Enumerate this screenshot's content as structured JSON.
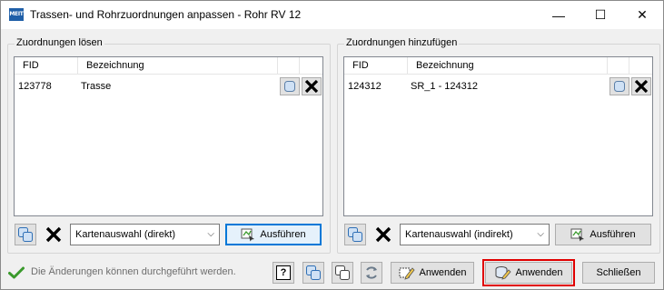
{
  "window": {
    "icon_text": "MEIT",
    "title": "Trassen- und Rohrzuordnungen anpassen - Rohr RV 12",
    "controls": {
      "minimize": "—",
      "maximize": "☐",
      "close": "✕"
    }
  },
  "left_group": {
    "label": "Zuordnungen lösen",
    "columns": [
      "FID",
      "Bezeichnung"
    ],
    "rows": [
      {
        "fid": "123778",
        "bezeichnung": "Trasse"
      }
    ],
    "dropdown_value": "Kartenauswahl (direkt)",
    "run_label": "Ausführen"
  },
  "right_group": {
    "label": "Zuordnungen hinzufügen",
    "columns": [
      "FID",
      "Bezeichnung"
    ],
    "rows": [
      {
        "fid": "124312",
        "bezeichnung": "SR_1 - 124312"
      }
    ],
    "dropdown_value": "Kartenauswahl (indirekt)",
    "run_label": "Ausführen"
  },
  "footer": {
    "status_text": "Die Änderungen können durchgeführt werden.",
    "help_label": "?",
    "apply_label_1": "Anwenden",
    "apply_label_2": "Anwenden",
    "close_label": "Schließen"
  },
  "colors": {
    "highlight_outline": "#e00000",
    "focus_border": "#0078d7",
    "status_check": "#3a9a2c"
  }
}
